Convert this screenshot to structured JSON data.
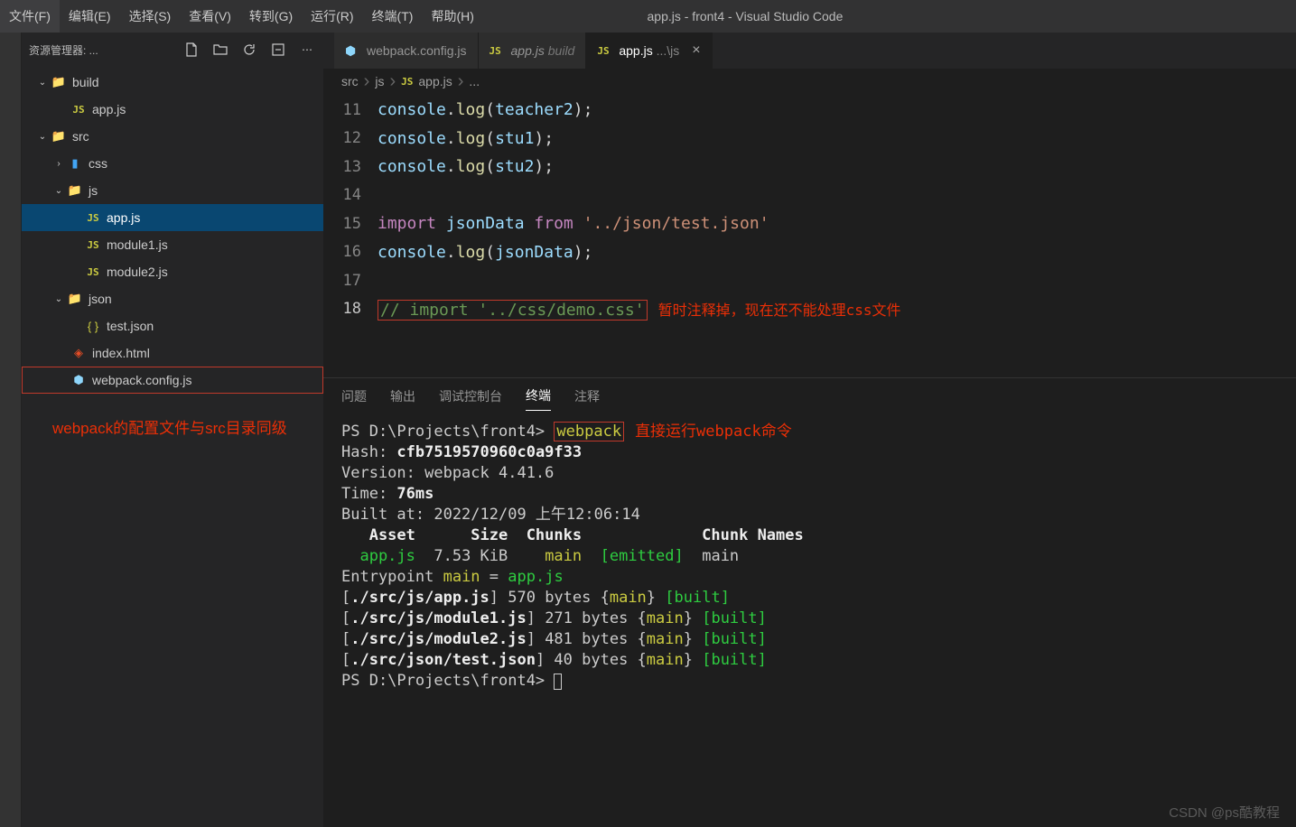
{
  "menubar": {
    "items": [
      "文件(F)",
      "编辑(E)",
      "选择(S)",
      "查看(V)",
      "转到(G)",
      "运行(R)",
      "终端(T)",
      "帮助(H)"
    ]
  },
  "title": "app.js - front4 - Visual Studio Code",
  "sidebar": {
    "header": "资源管理器: ...",
    "tree": {
      "build": "build",
      "build_app": "app.js",
      "src": "src",
      "css": "css",
      "js": "js",
      "app": "app.js",
      "mod1": "module1.js",
      "mod2": "module2.js",
      "json": "json",
      "test": "test.json",
      "index": "index.html",
      "webpack": "webpack.config.js"
    },
    "annotation": "webpack的配置文件与src目录同级"
  },
  "tabs": [
    {
      "icon": "webpack",
      "label": "webpack.config.js",
      "suffix": "",
      "active": false,
      "close": false
    },
    {
      "icon": "js",
      "label": "app.js",
      "suffix": "build",
      "italic": true,
      "active": false,
      "close": false
    },
    {
      "icon": "js",
      "label": "app.js",
      "suffix": "...\\js",
      "italic": false,
      "active": true,
      "close": true
    }
  ],
  "breadcrumb": {
    "p1": "src",
    "p2": "js",
    "p3": "app.js",
    "p4": "..."
  },
  "code": {
    "lines": [
      {
        "n": "11",
        "html": "<span class='tk-obj'>console</span><span class='tk-punc'>.</span><span class='tk-fn'>log</span><span class='tk-punc'>(</span><span class='tk-obj'>teacher2</span><span class='tk-punc'>);</span>"
      },
      {
        "n": "12",
        "html": "<span class='tk-obj'>console</span><span class='tk-punc'>.</span><span class='tk-fn'>log</span><span class='tk-punc'>(</span><span class='tk-obj'>stu1</span><span class='tk-punc'>);</span>"
      },
      {
        "n": "13",
        "html": "<span class='tk-obj'>console</span><span class='tk-punc'>.</span><span class='tk-fn'>log</span><span class='tk-punc'>(</span><span class='tk-obj'>stu2</span><span class='tk-punc'>);</span>"
      },
      {
        "n": "14",
        "html": ""
      },
      {
        "n": "15",
        "html": "<span class='tk-kw'>import</span> <span class='tk-obj'>jsonData</span> <span class='tk-kw'>from</span> <span class='tk-str'>'../json/test.json'</span>"
      },
      {
        "n": "16",
        "html": "<span class='tk-obj'>console</span><span class='tk-punc'>.</span><span class='tk-fn'>log</span><span class='tk-punc'>(</span><span class='tk-obj'>jsonData</span><span class='tk-punc'>);</span>"
      },
      {
        "n": "17",
        "html": ""
      }
    ],
    "line18": {
      "n": "18",
      "comment": "// import '../css/demo.css'",
      "annot": "暂时注释掉，现在还不能处理css文件"
    }
  },
  "panel": {
    "tabs": [
      "问题",
      "输出",
      "调试控制台",
      "终端",
      "注释"
    ],
    "active": 3
  },
  "terminal": {
    "prompt1": "PS D:\\Projects\\front4>",
    "cmd": "webpack",
    "cmd_annot": "直接运行webpack命令",
    "hash_label": "Hash: ",
    "hash_val": "cfb7519570960c0a9f33",
    "version": "Version: webpack 4.41.6",
    "time_label": "Time: ",
    "time_val": "76ms",
    "built": "Built at: 2022/12/09 上午12:06:14",
    "header": "   Asset      Size  Chunks             Chunk Names",
    "asset_name": "  app.js",
    "asset_rest": "  7.53 KiB    ",
    "asset_main": "main",
    "asset_emit": "[emitted]",
    "asset_tail": "  main",
    "entry_a": "Entrypoint ",
    "entry_b": "main",
    "entry_c": " = ",
    "entry_d": "app.js",
    "rows": [
      {
        "path": "./src/js/app.js",
        "size": "570 bytes"
      },
      {
        "path": "./src/js/module1.js",
        "size": "271 bytes"
      },
      {
        "path": "./src/js/module2.js",
        "size": "481 bytes"
      },
      {
        "path": "./src/json/test.json",
        "size": "40 bytes"
      }
    ],
    "main_token": "main",
    "built_token": "built",
    "prompt2": "PS D:\\Projects\\front4>"
  },
  "watermark": "CSDN @ps酷教程"
}
